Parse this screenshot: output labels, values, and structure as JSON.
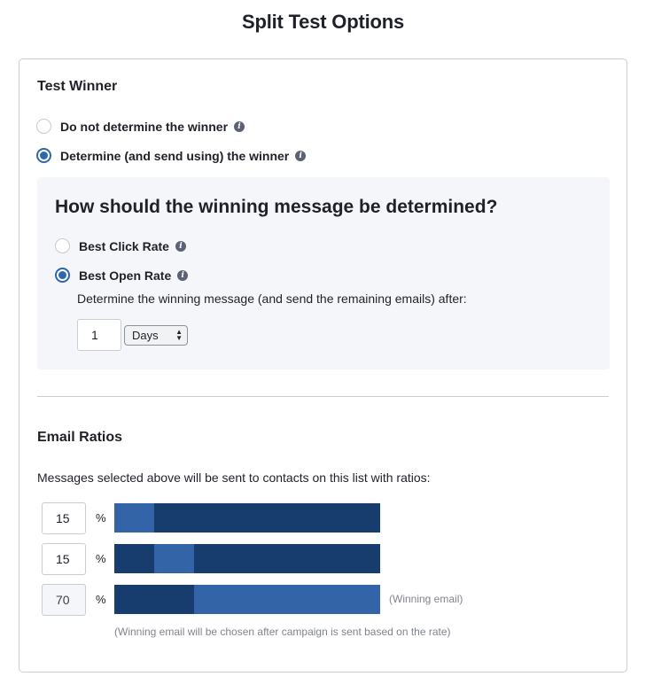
{
  "page": {
    "title": "Split Test Options"
  },
  "test_winner": {
    "title": "Test Winner",
    "options": [
      {
        "label": "Do not determine the winner",
        "checked": false
      },
      {
        "label": "Determine (and send using) the winner",
        "checked": true
      }
    ]
  },
  "determination": {
    "title": "How should the winning message be determined?",
    "options": [
      {
        "label": "Best Click Rate",
        "checked": false
      },
      {
        "label": "Best Open Rate",
        "checked": true
      }
    ],
    "helper": "Determine the winning message (and send the remaining emails) after:",
    "duration_value": "1",
    "duration_unit": "Days"
  },
  "email_ratios": {
    "title": "Email Ratios",
    "description": "Messages selected above will be sent to contacts on this list with ratios:",
    "percent_symbol": "%",
    "rows": [
      {
        "value": "15",
        "percent": 15,
        "offset": 0,
        "readonly": false,
        "note": ""
      },
      {
        "value": "15",
        "percent": 15,
        "offset": 15,
        "readonly": false,
        "note": ""
      },
      {
        "value": "70",
        "percent": 70,
        "offset": 30,
        "readonly": true,
        "note": "(Winning email)"
      }
    ],
    "footnote": "(Winning email will be chosen after campaign is sent based on the rate)",
    "colors": {
      "bar_base": "#173d6e",
      "bar_highlight": "#3364a8",
      "accent": "#2f66b0"
    }
  }
}
